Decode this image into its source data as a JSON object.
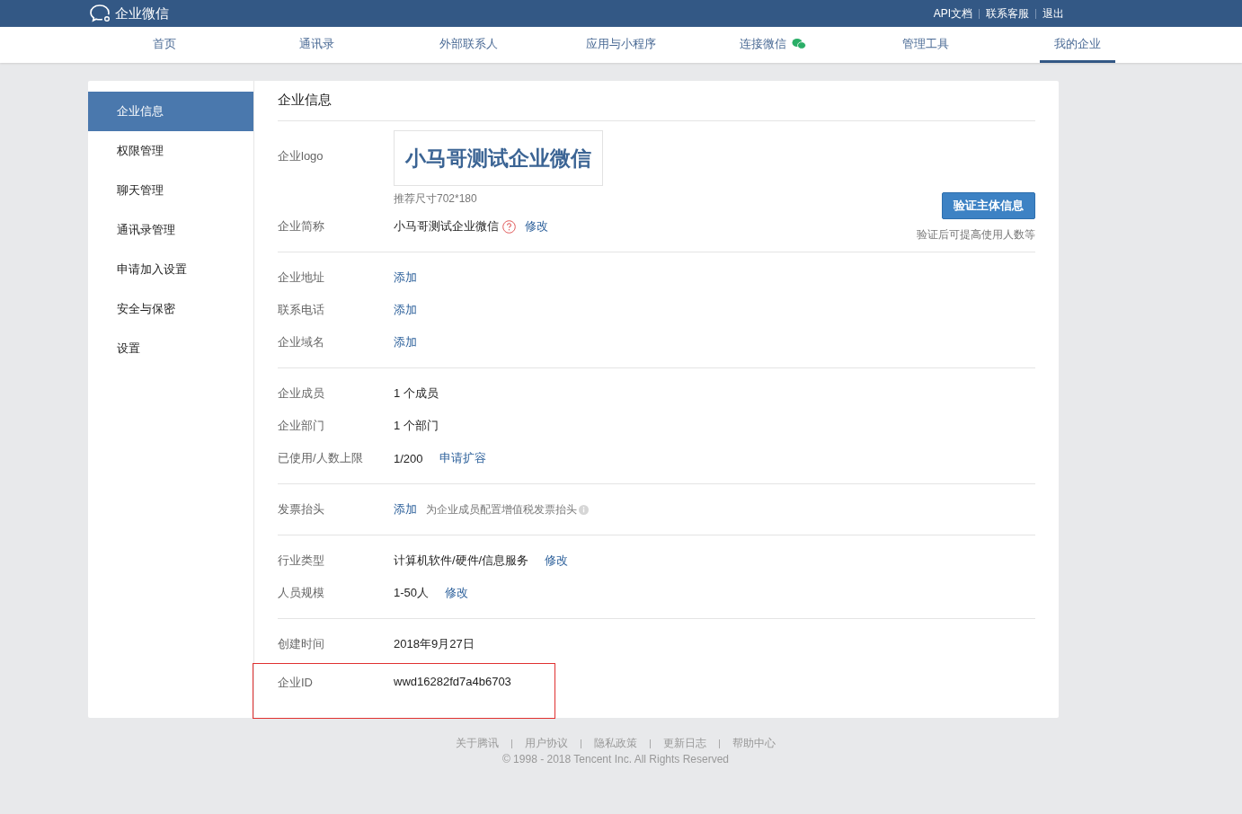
{
  "topbar": {
    "brand": "企业微信",
    "links": [
      "API文档",
      "联系客服",
      "退出"
    ]
  },
  "tabs": [
    {
      "label": "首页",
      "selected": false,
      "icon": false
    },
    {
      "label": "通讯录",
      "selected": false,
      "icon": false
    },
    {
      "label": "外部联系人",
      "selected": false,
      "icon": false
    },
    {
      "label": "应用与小程序",
      "selected": false,
      "icon": false
    },
    {
      "label": "连接微信",
      "selected": false,
      "icon": true
    },
    {
      "label": "管理工具",
      "selected": false,
      "icon": false
    },
    {
      "label": "我的企业",
      "selected": true,
      "icon": false
    }
  ],
  "sidebar": {
    "items": [
      {
        "label": "企业信息",
        "selected": true
      },
      {
        "label": "权限管理",
        "selected": false
      },
      {
        "label": "聊天管理",
        "selected": false
      },
      {
        "label": "通讯录管理",
        "selected": false
      },
      {
        "label": "申请加入设置",
        "selected": false
      },
      {
        "label": "安全与保密",
        "selected": false
      },
      {
        "label": "设置",
        "selected": false
      }
    ]
  },
  "title": "企业信息",
  "verify": {
    "button": "验证主体信息",
    "note": "验证后可提高使用人数等"
  },
  "sections": [
    {
      "rows": [
        {
          "kind": "logo",
          "label": "企业logo",
          "value": "小马哥测试企业微信",
          "hint": "推荐尺寸702*180"
        },
        {
          "kind": "field",
          "label": "企业简称",
          "value": "小马哥测试企业微信",
          "help": true,
          "actions": [
            "修改"
          ]
        }
      ]
    },
    {
      "rows": [
        {
          "kind": "field",
          "label": "企业地址",
          "actions": [
            "添加"
          ]
        },
        {
          "kind": "field",
          "label": "联系电话",
          "actions": [
            "添加"
          ]
        },
        {
          "kind": "field",
          "label": "企业域名",
          "actions": [
            "添加"
          ]
        }
      ]
    },
    {
      "rows": [
        {
          "kind": "field",
          "label": "企业成员",
          "value": "1 个成员"
        },
        {
          "kind": "field",
          "label": "企业部门",
          "value": "1 个部门"
        },
        {
          "kind": "field",
          "label": "已使用/人数上限",
          "value": "1/200",
          "actions": [
            "申请扩容"
          ]
        }
      ]
    },
    {
      "rows": [
        {
          "kind": "field",
          "label": "发票抬头",
          "actions": [
            "添加"
          ],
          "note": "为企业成员配置增值税发票抬头"
        }
      ]
    },
    {
      "rows": [
        {
          "kind": "field",
          "label": "行业类型",
          "value": "计算机软件/硬件/信息服务",
          "actions": [
            "修改"
          ]
        },
        {
          "kind": "field",
          "label": "人员规模",
          "value": "1-50人",
          "actions": [
            "修改"
          ]
        }
      ]
    },
    {
      "rows": [
        {
          "kind": "field",
          "label": "创建时间",
          "value": "2018年9月27日"
        },
        {
          "kind": "field",
          "label": "企业ID",
          "value": "wwd16282fd7a4b6703",
          "highlighted": true
        }
      ]
    }
  ],
  "footer": {
    "links": [
      "关于腾讯",
      "用户协议",
      "隐私政策",
      "更新日志",
      "帮助中心"
    ],
    "copyright": "© 1998 - 2018 Tencent Inc. All Rights Reserved"
  }
}
